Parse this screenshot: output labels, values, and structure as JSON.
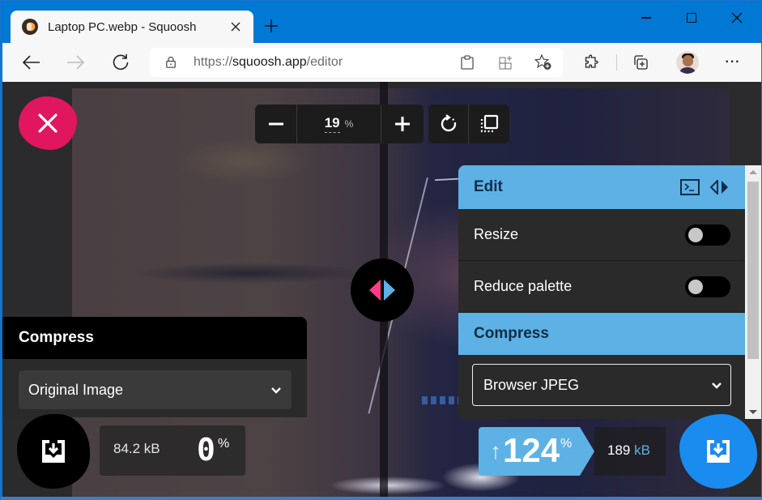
{
  "browser": {
    "tab": {
      "title": "Laptop PC.webp - Squoosh",
      "close_icon": "close-icon",
      "favicon": "squoosh-favicon"
    },
    "new_tab_label": "+",
    "window_controls": [
      "minimize",
      "maximize",
      "close"
    ],
    "address": {
      "scheme": "https://",
      "host": "squoosh.app",
      "path": "/editor"
    },
    "toolbar_icons": [
      "back-icon",
      "forward-icon",
      "refresh-icon",
      "lock-icon",
      "clipboard-icon",
      "app-grid-icon",
      "favorite-add-icon",
      "extensions-icon",
      "collections-icon",
      "profile-avatar",
      "more-icon"
    ],
    "more_label": "···"
  },
  "editor": {
    "zoom": {
      "value": "19",
      "unit": "%"
    },
    "edit_panel": {
      "title": "Edit",
      "header_icons": [
        "terminal-icon",
        "swap-sides-icon"
      ],
      "options": [
        {
          "label": "Resize",
          "enabled": false
        },
        {
          "label": "Reduce palette",
          "enabled": false
        }
      ],
      "compress_title": "Compress",
      "codec_selected": "Browser JPEG"
    },
    "left_panel": {
      "title": "Compress",
      "codec_selected": "Original Image"
    },
    "left_result": {
      "size": "84.2 kB",
      "percent": "0",
      "percent_sign": "%"
    },
    "right_result": {
      "arrow": "↑",
      "percent": "124",
      "percent_sign": "%",
      "size_value": "189",
      "size_unit": "kB"
    },
    "colors": {
      "accent_pink": "#e0165e",
      "accent_blue": "#5db1e4",
      "download_blue": "#1a8cf0",
      "panel_dark": "#2a2a2a"
    }
  }
}
